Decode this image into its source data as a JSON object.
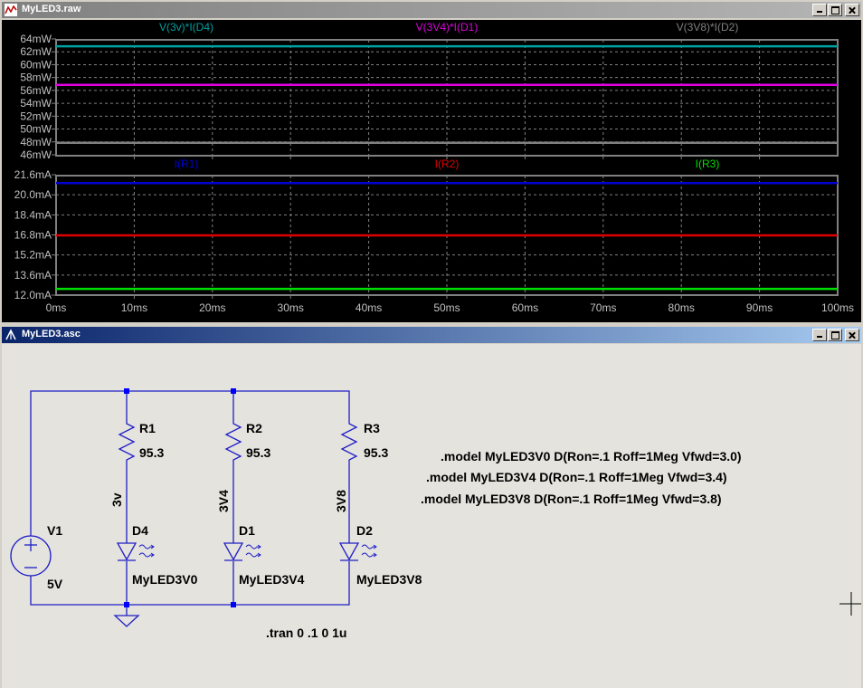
{
  "plot_window": {
    "title": "MyLED3.raw",
    "window_buttons": [
      "minimize",
      "maximize",
      "close"
    ]
  },
  "schematic_window": {
    "title": "MyLED3.asc",
    "window_buttons": [
      "minimize",
      "maximize",
      "close"
    ]
  },
  "colors": {
    "plot_bg": "#000000",
    "grid": "#808080",
    "axis_text": "#c0c0c0",
    "schematic_bg": "#e5e3dd",
    "wire": "#1f1fc7",
    "node": "#0000ff"
  },
  "chart_data": [
    {
      "type": "line",
      "x": [
        0,
        100
      ],
      "xlim": [
        0,
        100
      ],
      "ylim": [
        46,
        64
      ],
      "yticks": [
        "64mW",
        "62mW",
        "60mW",
        "58mW",
        "56mW",
        "54mW",
        "52mW",
        "50mW",
        "48mW",
        "46mW"
      ],
      "xticks": [],
      "grid": true,
      "series": [
        {
          "name": "V(3v)*I(D4)",
          "color": "#00a0a0",
          "values": [
            63.0,
            63.0
          ]
        },
        {
          "name": "V(3V4)*I(D1)",
          "color": "#e000e0",
          "values": [
            57.0,
            57.0
          ]
        },
        {
          "name": "V(3V8)*I(D2)",
          "color": "#808080",
          "values": [
            48.0,
            48.0
          ]
        }
      ]
    },
    {
      "type": "line",
      "x": [
        0,
        100
      ],
      "xlim": [
        0,
        100
      ],
      "ylim": [
        12.0,
        21.6
      ],
      "yticks": [
        "21.6mA",
        "20.0mA",
        "18.4mA",
        "16.8mA",
        "15.2mA",
        "13.6mA",
        "12.0mA"
      ],
      "xticks": [
        "0ms",
        "10ms",
        "20ms",
        "30ms",
        "40ms",
        "50ms",
        "60ms",
        "70ms",
        "80ms",
        "90ms",
        "100ms"
      ],
      "grid": true,
      "series": [
        {
          "name": "I(R1)",
          "color": "#0000d0",
          "values": [
            21.0,
            21.0
          ]
        },
        {
          "name": "I(R2)",
          "color": "#e00000",
          "values": [
            16.8,
            16.8
          ]
        },
        {
          "name": "I(R3)",
          "color": "#00e000",
          "values": [
            12.5,
            12.5
          ]
        }
      ]
    }
  ],
  "schematic": {
    "source": {
      "name": "V1",
      "value": "5V"
    },
    "branches": [
      {
        "resistor": "R1",
        "r_value": "95.3",
        "net": "3v",
        "diode": "D4",
        "model": "MyLED3V0"
      },
      {
        "resistor": "R2",
        "r_value": "95.3",
        "net": "3V4",
        "diode": "D1",
        "model": "MyLED3V4"
      },
      {
        "resistor": "R3",
        "r_value": "95.3",
        "net": "3V8",
        "diode": "D2",
        "model": "MyLED3V8"
      }
    ],
    "directives": [
      ".model MyLED3V0 D(Ron=.1 Roff=1Meg Vfwd=3.0)",
      ".model MyLED3V4 D(Ron=.1 Roff=1Meg Vfwd=3.4)",
      ".model MyLED3V8 D(Ron=.1 Roff=1Meg Vfwd=3.8)"
    ],
    "tran": ".tran 0 .1 0 1u"
  }
}
